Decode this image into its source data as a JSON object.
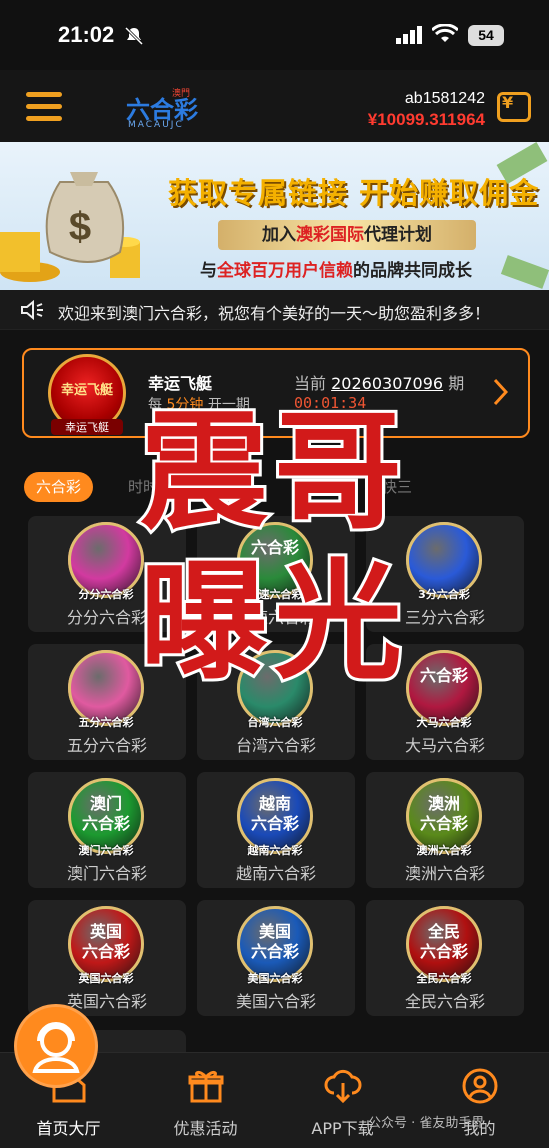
{
  "status_bar": {
    "time": "21:02",
    "battery": "54"
  },
  "header": {
    "logo_text": "六合彩",
    "logo_tag": "澳門",
    "logo_sub": "MACAUJC",
    "username": "ab1581242",
    "balance": "¥10099.311964"
  },
  "banner": {
    "title": "获取专属链接 开始赚取佣金",
    "pill_pre": "加入",
    "pill_hl": "澳彩国际",
    "pill_post": "代理计划",
    "line2_pre": "与",
    "line2_hl": "全球百万用户信赖",
    "line2_post": "的品牌共同成长"
  },
  "marquee": {
    "text": "欢迎来到澳门六合彩，祝您有个美好的一天～助您盈利多多！"
  },
  "draw_card": {
    "badge_label": "幸运飞艇",
    "badge_sub": "幸运飞艇",
    "game_name": "幸运飞艇",
    "freq_pre": "每",
    "freq_hl": "5分钟",
    "freq_post": "开一期",
    "current_label": "当前",
    "period": "20260307096",
    "period_suffix": "期",
    "countdown": "00:01:34"
  },
  "tabs": [
    {
      "label": "六合彩",
      "active": true
    },
    {
      "label": "时时彩",
      "active": false
    },
    {
      "label": "PK10",
      "active": false
    },
    {
      "label": "低频彩",
      "active": false
    },
    {
      "label": "快三",
      "active": false
    }
  ],
  "games": [
    {
      "name": "分分六合彩",
      "ball_text": "",
      "ball_foot": "分分六合彩",
      "color": "#d23aa0"
    },
    {
      "name": "极速六合彩",
      "ball_text": "六合彩",
      "ball_foot": "极速六合彩",
      "color": "#2a8a3a"
    },
    {
      "name": "三分六合彩",
      "ball_text": "",
      "ball_foot": "3分六合彩",
      "color": "#2a5ad8"
    },
    {
      "name": "五分六合彩",
      "ball_text": "",
      "ball_foot": "五分六合彩",
      "color": "#e05aa0"
    },
    {
      "name": "台湾六合彩",
      "ball_text": "",
      "ball_foot": "台湾六合彩",
      "color": "#2a8a6a"
    },
    {
      "name": "大马六合彩",
      "ball_text": "六合彩",
      "ball_foot": "大马六合彩",
      "color": "#b01840"
    },
    {
      "name": "澳门六合彩",
      "ball_text": "澳门\n六合彩",
      "ball_foot": "澳门六合彩",
      "color": "#1c9a30"
    },
    {
      "name": "越南六合彩",
      "ball_text": "越南\n六合彩",
      "ball_foot": "越南六合彩",
      "color": "#1a4ab8"
    },
    {
      "name": "澳洲六合彩",
      "ball_text": "澳洲\n六合彩",
      "ball_foot": "澳洲六合彩",
      "color": "#5a8a1a"
    },
    {
      "name": "英国六合彩",
      "ball_text": "英国\n六合彩",
      "ball_foot": "英国六合彩",
      "color": "#c01818"
    },
    {
      "name": "美国六合彩",
      "ball_text": "美国\n六合彩",
      "ball_foot": "美国六合彩",
      "color": "#1a5ab8"
    },
    {
      "name": "全民六合彩",
      "ball_text": "全民\n六合彩",
      "ball_foot": "全民六合彩",
      "color": "#b01010"
    }
  ],
  "watermark": {
    "line1": "震哥",
    "line2": "曝光"
  },
  "bottom_nav": [
    {
      "label": "首页大厅",
      "icon": "home-icon",
      "active": true
    },
    {
      "label": "优惠活动",
      "icon": "gift-icon",
      "active": false
    },
    {
      "label": "APP下载",
      "icon": "cloud-download-icon",
      "active": false
    },
    {
      "label": "我的",
      "icon": "user-icon",
      "active": false
    }
  ],
  "wechat_mark": "公众号 · 雀友助手界"
}
